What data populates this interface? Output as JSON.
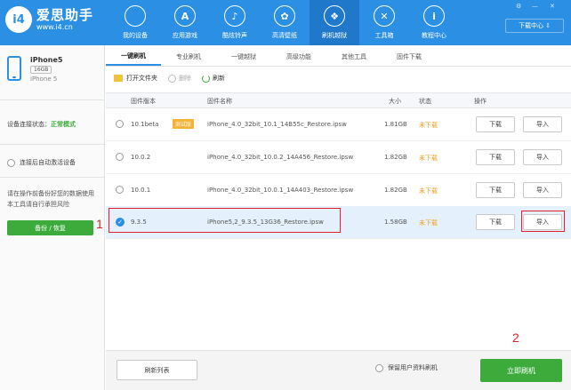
{
  "app": {
    "logo_badge": "i4",
    "name": "爱思助手",
    "url": "www.i4.cn",
    "download_center": "下载中心 ⇩"
  },
  "nav": [
    {
      "label": "我的设备",
      "icon": "apple-icon",
      "glyph": ""
    },
    {
      "label": "应用游戏",
      "icon": "appstore-icon",
      "glyph": "A"
    },
    {
      "label": "酷炫铃声",
      "icon": "bell-icon",
      "glyph": "♪"
    },
    {
      "label": "高清壁纸",
      "icon": "flower-icon",
      "glyph": "✿"
    },
    {
      "label": "刷机越狱",
      "icon": "dropbox-icon",
      "glyph": "❖"
    },
    {
      "label": "工具箱",
      "icon": "tools-icon",
      "glyph": "✕"
    },
    {
      "label": "教程中心",
      "icon": "info-icon",
      "glyph": "i"
    }
  ],
  "device": {
    "name": "iPhone5",
    "capacity": "16GB",
    "model": "iPhone 5"
  },
  "sidebar": {
    "conn_label": "设备连接状态：",
    "conn_value": "正常模式",
    "auto_activate": "连接后自动激活设备",
    "warning": "请在操作前备份好您的数据使用本工具请自行承担风险",
    "backup_btn": "备份 / 恢复"
  },
  "subtabs": [
    "一键刷机",
    "专业刷机",
    "一键越狱",
    "高级功能",
    "其他工具",
    "固件下载"
  ],
  "toolbar": {
    "open_folder": "打开文件夹",
    "delete": "删除",
    "refresh": "刷新"
  },
  "table": {
    "headers": {
      "version": "固件版本",
      "name": "固件名称",
      "size": "大小",
      "status": "状态",
      "action": "操作"
    },
    "rows": [
      {
        "version": "10.1beta",
        "tag": "测试版",
        "name": "iPhone_4.0_32bit_10.1_14B55c_Restore.ipsw",
        "size": "1.81GB",
        "status": "未下载",
        "download": "下载",
        "import": "导入"
      },
      {
        "version": "10.0.2",
        "tag": "",
        "name": "iPhone_4.0_32bit_10.0.2_14A456_Restore.ipsw",
        "size": "1.82GB",
        "status": "未下载",
        "download": "下载",
        "import": "导入"
      },
      {
        "version": "10.0.1",
        "tag": "",
        "name": "iPhone_4.0_32bit_10.0.1_14A403_Restore.ipsw",
        "size": "1.82GB",
        "status": "未下载",
        "download": "下载",
        "import": "导入"
      },
      {
        "version": "9.3.5",
        "tag": "",
        "name": "iPhone5,2_9.3.5_13G36_Restore.ipsw",
        "size": "1.58GB",
        "status": "未下载",
        "download": "下载",
        "import": "导入"
      }
    ]
  },
  "footer": {
    "refresh_list": "刷新列表",
    "keep_data": "保留用户资料刷机",
    "flash_now": "立即刷机"
  },
  "annotations": {
    "one": "1",
    "two": "2"
  },
  "colors": {
    "brand": "#2b8fe3",
    "green": "#3cab3c",
    "annotation_red": "#e0202a",
    "status_orange": "#f0a020"
  }
}
